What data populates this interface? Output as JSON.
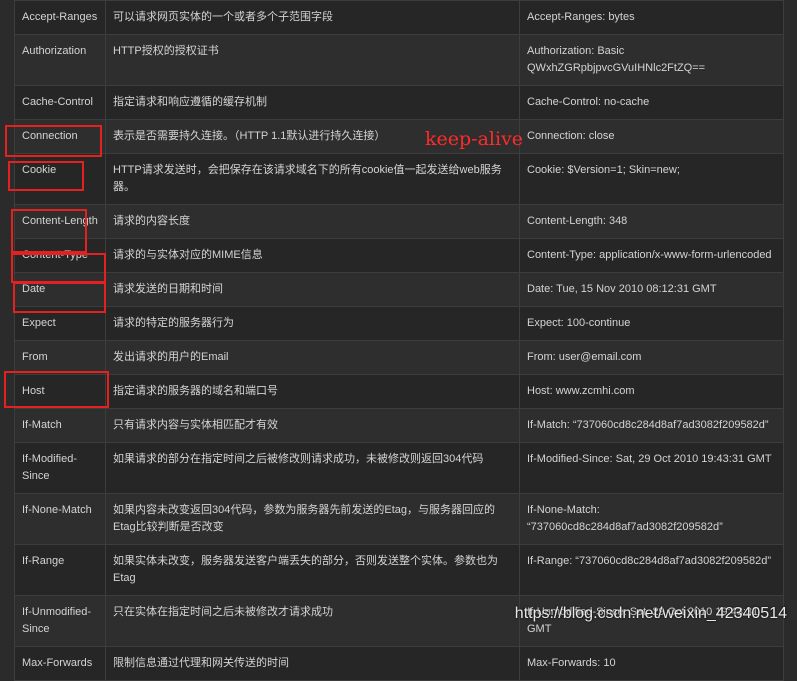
{
  "rows": [
    {
      "name": "Accept-Ranges",
      "desc": "可以请求网页实体的一个或者多个子范围字段",
      "example": "Accept-Ranges: bytes"
    },
    {
      "name": "Authorization",
      "desc": "HTTP授权的授权证书",
      "example": "Authorization: Basic QWxhZGRpbjpvcGVuIHNlc2FtZQ=="
    },
    {
      "name": "Cache-Control",
      "desc": "指定请求和响应遵循的缓存机制",
      "example": "Cache-Control: no-cache"
    },
    {
      "name": "Connection",
      "desc": "表示是否需要持久连接。（HTTP 1.1默认进行持久连接）",
      "example": "Connection: close"
    },
    {
      "name": "Cookie",
      "desc": "HTTP请求发送时，会把保存在该请求域名下的所有cookie值一起发送给web服务器。",
      "example": "Cookie: $Version=1; Skin=new;"
    },
    {
      "name": "Content-Length",
      "desc": "请求的内容长度",
      "example": "Content-Length: 348"
    },
    {
      "name": "Content-Type",
      "desc": "请求的与实体对应的MIME信息",
      "example": "Content-Type: application/x-www-form-urlencoded"
    },
    {
      "name": "Date",
      "desc": "请求发送的日期和时间",
      "example": "Date: Tue, 15 Nov 2010 08:12:31 GMT"
    },
    {
      "name": "Expect",
      "desc": "请求的特定的服务器行为",
      "example": "Expect: 100-continue"
    },
    {
      "name": "From",
      "desc": "发出请求的用户的Email",
      "example": "From: user@email.com"
    },
    {
      "name": "Host",
      "desc": "指定请求的服务器的域名和端口号",
      "example": "Host: www.zcmhi.com"
    },
    {
      "name": "If-Match",
      "desc": "只有请求内容与实体相匹配才有效",
      "example": "If-Match: “737060cd8c284d8af7ad3082f209582d”"
    },
    {
      "name": "If-Modified-Since",
      "desc": "如果请求的部分在指定时间之后被修改则请求成功，未被修改则返回304代码",
      "example": "If-Modified-Since: Sat, 29 Oct 2010 19:43:31 GMT"
    },
    {
      "name": "If-None-Match",
      "desc": "如果内容未改变返回304代码，参数为服务器先前发送的Etag，与服务器回应的Etag比较判断是否改变",
      "example": "If-None-Match: “737060cd8c284d8af7ad3082f209582d”"
    },
    {
      "name": "If-Range",
      "desc": "如果实体未改变，服务器发送客户端丢失的部分，否则发送整个实体。参数也为Etag",
      "example": "If-Range: “737060cd8c284d8af7ad3082f209582d”"
    },
    {
      "name": "If-Unmodified-Since",
      "desc": "只在实体在指定时间之后未被修改才请求成功",
      "example": "If-Unmodified-Since: Sat, 29 Oct 2010 19:43:31 GMT"
    },
    {
      "name": "Max-Forwards",
      "desc": "限制信息通过代理和网关传送的时间",
      "example": "Max-Forwards: 10"
    }
  ],
  "annotation": "keep-alive",
  "watermark": "https://blog.csdn.net/weixin_42340514"
}
